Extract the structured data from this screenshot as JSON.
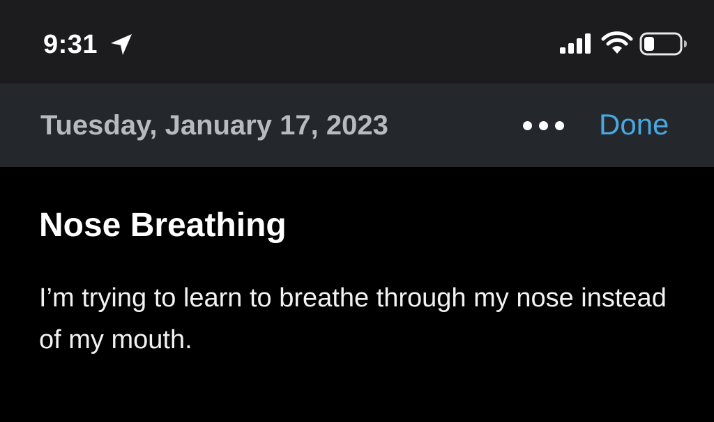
{
  "status_bar": {
    "time": "9:31",
    "location_icon": "location-arrow-icon",
    "signal_icon": "cellular-signal-icon",
    "wifi_icon": "wifi-icon",
    "battery_icon": "battery-icon",
    "battery_level": 0.3
  },
  "nav_bar": {
    "date": "Tuesday, January 17, 2023",
    "more_icon": "more-dots-icon",
    "done_label": "Done"
  },
  "entry": {
    "title": "Nose Breathing",
    "body": "I’m trying to learn to breathe through my nose instead of my mouth."
  },
  "colors": {
    "status_bar_bg": "#1c1c1e",
    "nav_bar_bg": "#24282c",
    "content_bg": "#000000",
    "date_text": "#b8bbbe",
    "accent": "#4aa8e0"
  }
}
